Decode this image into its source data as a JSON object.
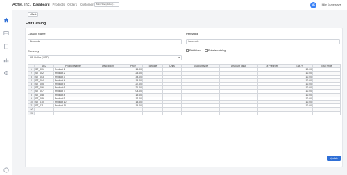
{
  "app": {
    "brand": "Acme, Inc."
  },
  "nav": {
    "items": [
      "Dashboard",
      "Products",
      "Orders",
      "Customers"
    ]
  },
  "switcher": {
    "label": "Main Site (default) ⌄"
  },
  "user": {
    "initials": "MK",
    "name": "Mike Kuznetsov ▾"
  },
  "sidebar": {
    "icons": [
      "home-icon",
      "catalog-icon",
      "document-icon",
      "chart-icon",
      "settings-icon",
      "help-icon"
    ]
  },
  "toolbar": {
    "back_label": "‹ Back"
  },
  "page": {
    "title": "Edit Catalog"
  },
  "form": {
    "catalog_name_label": "Catalog Name",
    "catalog_name_value": "Products",
    "permalink_label": "Permalink",
    "permalink_value": "/products",
    "currency_label": "Currency",
    "currency_value": "US Dollar (USD)",
    "published_label": "Published",
    "private_label": "Private catalog"
  },
  "table": {
    "columns": [
      "",
      "SKU",
      "Product Name",
      "Description",
      "Price",
      "Barcode",
      "Units",
      "Discount type",
      "Discount value",
      "# Preorder",
      "Tax, %",
      "Total Price"
    ],
    "rows": [
      [
        "1",
        "ST_001",
        "Product 1",
        "",
        "15.00",
        "",
        "",
        "",
        "",
        "",
        "10.00",
        ""
      ],
      [
        "2",
        "ST_002",
        "Product 2",
        "",
        "25.00",
        "",
        "",
        "",
        "",
        "",
        "10.00",
        ""
      ],
      [
        "3",
        "ST_003",
        "Product 3",
        "",
        "38.00",
        "",
        "",
        "",
        "",
        "",
        "10.00",
        ""
      ],
      [
        "4",
        "ST_004",
        "Product 4",
        "",
        "15.00",
        "",
        "",
        "",
        "",
        "",
        "10.00",
        ""
      ],
      [
        "5",
        "ST_005",
        "Product 5",
        "",
        "27.00",
        "",
        "",
        "",
        "",
        "",
        "10.00",
        ""
      ],
      [
        "6",
        "ST_006",
        "Product 6",
        "",
        "21.00",
        "",
        "",
        "",
        "",
        "",
        "10.00",
        ""
      ],
      [
        "7",
        "ST_007",
        "Product 7",
        "",
        "08.00",
        "",
        "",
        "",
        "",
        "",
        "10.00",
        ""
      ],
      [
        "8",
        "ST_008",
        "Product 8",
        "",
        "19.00",
        "",
        "",
        "",
        "",
        "",
        "10.00",
        ""
      ],
      [
        "9",
        "ST_009",
        "Product 9",
        "",
        "12.00",
        "",
        "",
        "",
        "",
        "",
        "10.00",
        ""
      ],
      [
        "10",
        "ST_010",
        "Product 10",
        "",
        "15.00",
        "",
        "",
        "",
        "",
        "",
        "10.00",
        ""
      ],
      [
        "11",
        "ST_011",
        "Product 11",
        "",
        "15.00",
        "",
        "",
        "",
        "",
        "",
        "10.00",
        ""
      ],
      [
        "12",
        "",
        "",
        "",
        "",
        "",
        "",
        "",
        "",
        "",
        "",
        ""
      ],
      [
        "13",
        "",
        "",
        "",
        "",
        "",
        "",
        "",
        "",
        "",
        "",
        ""
      ]
    ]
  },
  "actions": {
    "update_label": "Update"
  }
}
